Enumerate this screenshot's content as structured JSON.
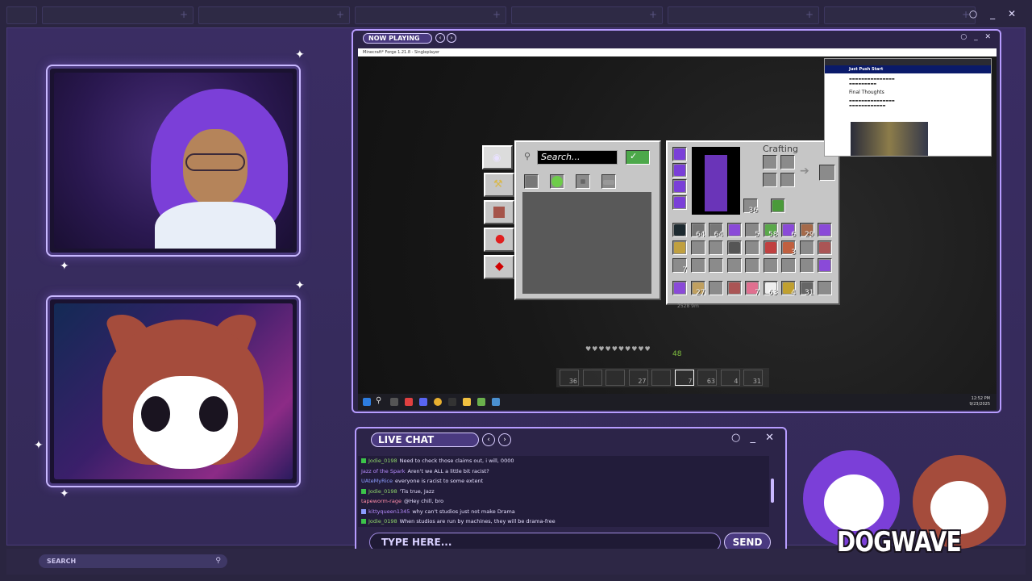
{
  "overlay": {
    "now_playing_label": "NOW PLAYING",
    "live_chat_label": "LIVE CHAT",
    "chat_input_placeholder": "TYPE HERE...",
    "send_label": "SEND",
    "search_label": "SEARCH",
    "logo_text": "DOGWAVE",
    "win_controls": "○ _ ✕"
  },
  "game": {
    "window_title": "Minecraft* Forge 1.21.8 - Singleplayer",
    "search_placeholder": "Search...",
    "crafting_label": "Crafting",
    "armor_count": "36",
    "inventory_counts": [
      "64",
      "64",
      "5",
      "58",
      "6",
      "29",
      "3",
      "7",
      "27",
      "7",
      "63",
      "4",
      "31"
    ],
    "hotbar_counts": [
      "36",
      "27",
      "7",
      "63",
      "4",
      "31"
    ],
    "hud_level": "48",
    "coords": "2528 9m"
  },
  "browser": {
    "site_title": "Just Push Start",
    "heading": "Final Thoughts"
  },
  "taskbar": {
    "time": "12:52 PM",
    "date": "9/23/2025"
  },
  "chat": {
    "messages": [
      {
        "user": "Jodie_0198",
        "text": "Need to check those claims out, i will, 0000",
        "color": "#8fd66a",
        "badge": "#3cc44a"
      },
      {
        "user": "Jazz of the Spark",
        "text": "Aren't we ALL a little bit racist?",
        "color": "#b78cff",
        "badge": ""
      },
      {
        "user": "UAteMyRice",
        "text": "everyone is racist to some extent",
        "color": "#8c9cff",
        "badge": ""
      },
      {
        "user": "Jodie_0198",
        "text": "'Tis true, Jazz",
        "color": "#8fd66a",
        "badge": "#3cc44a"
      },
      {
        "user": "tapeworm-rage",
        "text": "@Hey chill, bro",
        "color": "#ff8ca8",
        "badge": ""
      },
      {
        "user": "kittyqueen1345",
        "text": "why can't studios just not make Drama",
        "color": "#b78cff",
        "badge": "#8c9cff"
      },
      {
        "user": "Jodie_0198",
        "text": "When studios are run by machines, they will be drama-free",
        "color": "#8fd66a",
        "badge": "#3cc44a"
      }
    ]
  },
  "colors": {
    "accent": "#b79cff",
    "panel": "#2c2448",
    "background": "#2a2540"
  }
}
